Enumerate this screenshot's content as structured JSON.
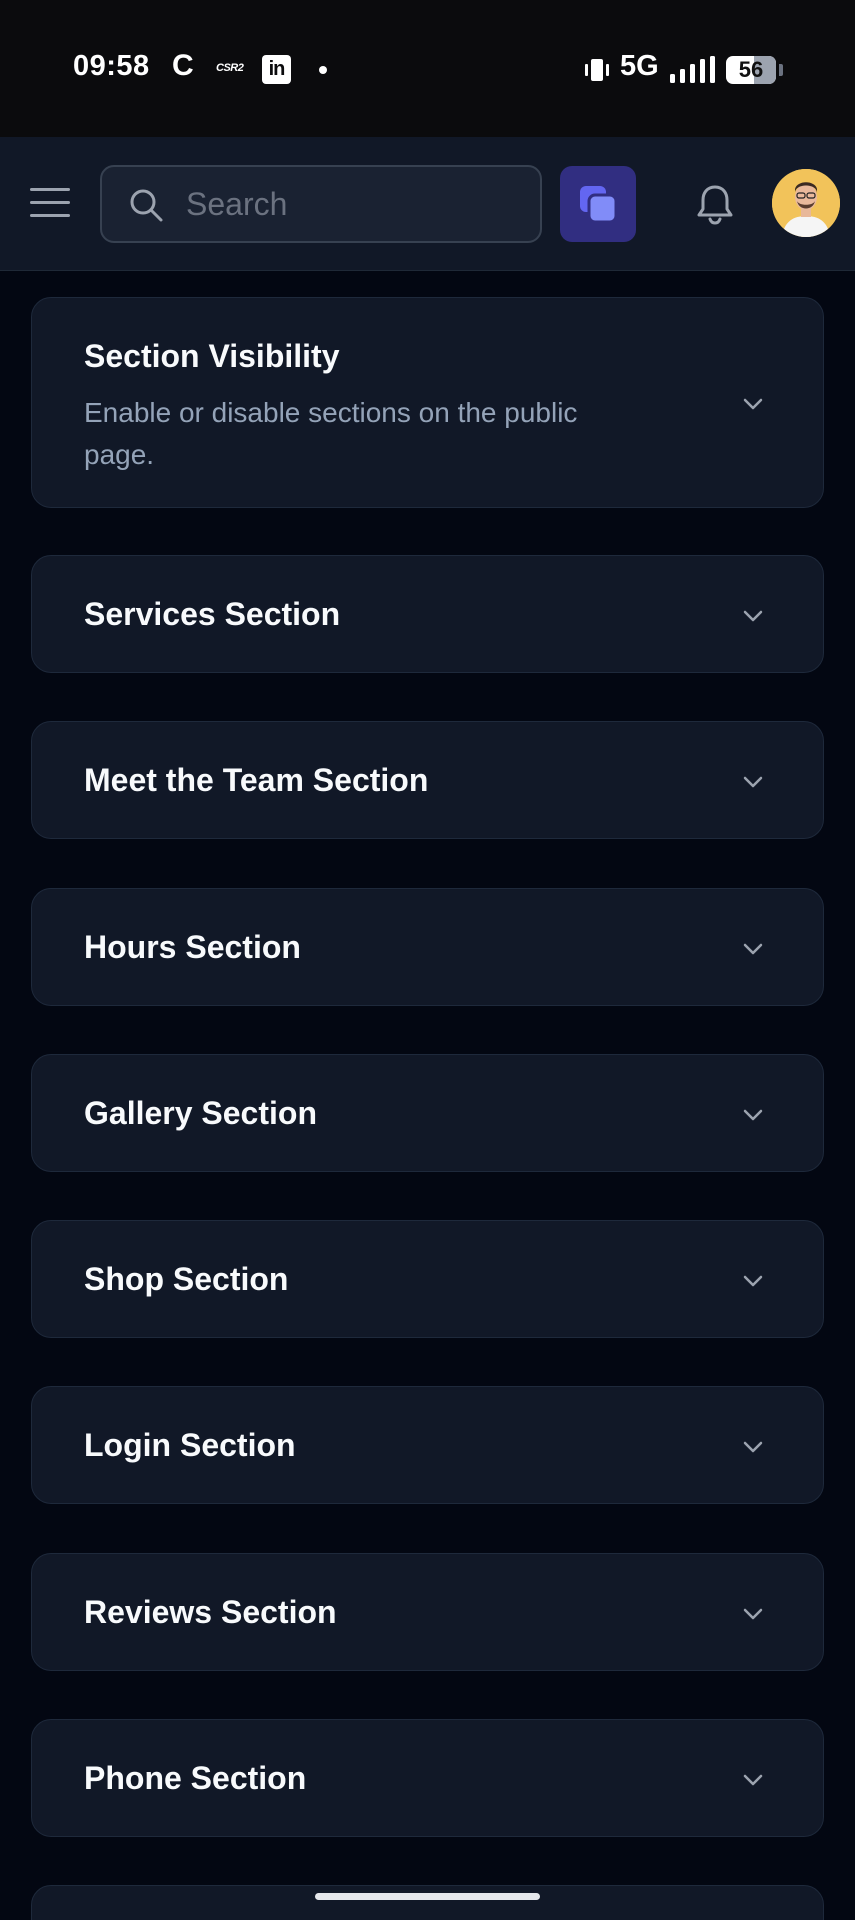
{
  "status_bar": {
    "time": "09:58",
    "c_icon_letter": "C",
    "csr_icon_text": "CSR2",
    "linkedin_icon_text": "in",
    "network": "5G",
    "battery": "56"
  },
  "header": {
    "search_placeholder": "Search",
    "icons": [
      "menu-icon",
      "search-icon",
      "copy-icon",
      "bell-icon",
      "avatar"
    ],
    "accent_color": "#818cf8"
  },
  "sections": [
    {
      "title": "Section Visibility",
      "description": "Enable or disable sections on the public page."
    },
    {
      "title": "Services Section"
    },
    {
      "title": "Meet the Team Section"
    },
    {
      "title": "Hours Section"
    },
    {
      "title": "Gallery Section"
    },
    {
      "title": "Shop Section"
    },
    {
      "title": "Login Section"
    },
    {
      "title": "Reviews Section"
    },
    {
      "title": "Phone Section"
    }
  ],
  "colors": {
    "background": "#030712",
    "card": "#111827",
    "header": "#111827",
    "muted_text": "#94a3b8"
  }
}
